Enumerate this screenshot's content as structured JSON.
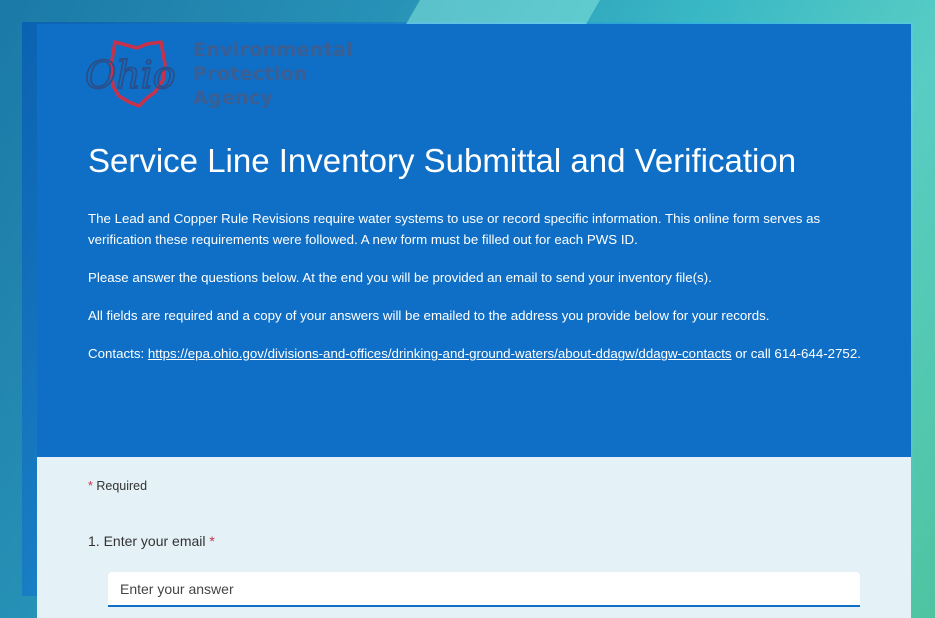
{
  "header": {
    "logo": {
      "mark_text": "Ohio",
      "lines": [
        "Environmental",
        "Protection",
        "Agency"
      ]
    },
    "title": "Service Line Inventory Submittal and Verification",
    "paragraphs": [
      "The Lead and Copper Rule Revisions require water systems to use or record specific information.  This online form serves as verification these requirements were followed. A new form must be filled out for each PWS ID.",
      "Please answer the questions below. At the end you will be provided an email to send your inventory file(s).",
      "All fields are required and a copy of your answers will be emailed to the address you provide below for your records."
    ],
    "contacts": {
      "prefix": "Contacts: ",
      "link_text": "https://epa.ohio.gov/divisions-and-offices/drinking-and-ground-waters/about-ddagw/ddagw-contacts",
      "suffix": " or call 614-644-2752."
    }
  },
  "form": {
    "required_star": "*",
    "required_label": " Required",
    "questions": [
      {
        "label": "1. Enter your email ",
        "required_star": "*",
        "placeholder": "Enter your answer",
        "value": ""
      }
    ]
  },
  "colors": {
    "header_bg": "#0f6fc6",
    "body_bg": "#e4f1f6",
    "required": "#c4314b",
    "logo_text": "#3b5e93",
    "logo_ohio": "#2a4f8a",
    "logo_state_outline": "#c8314b"
  }
}
